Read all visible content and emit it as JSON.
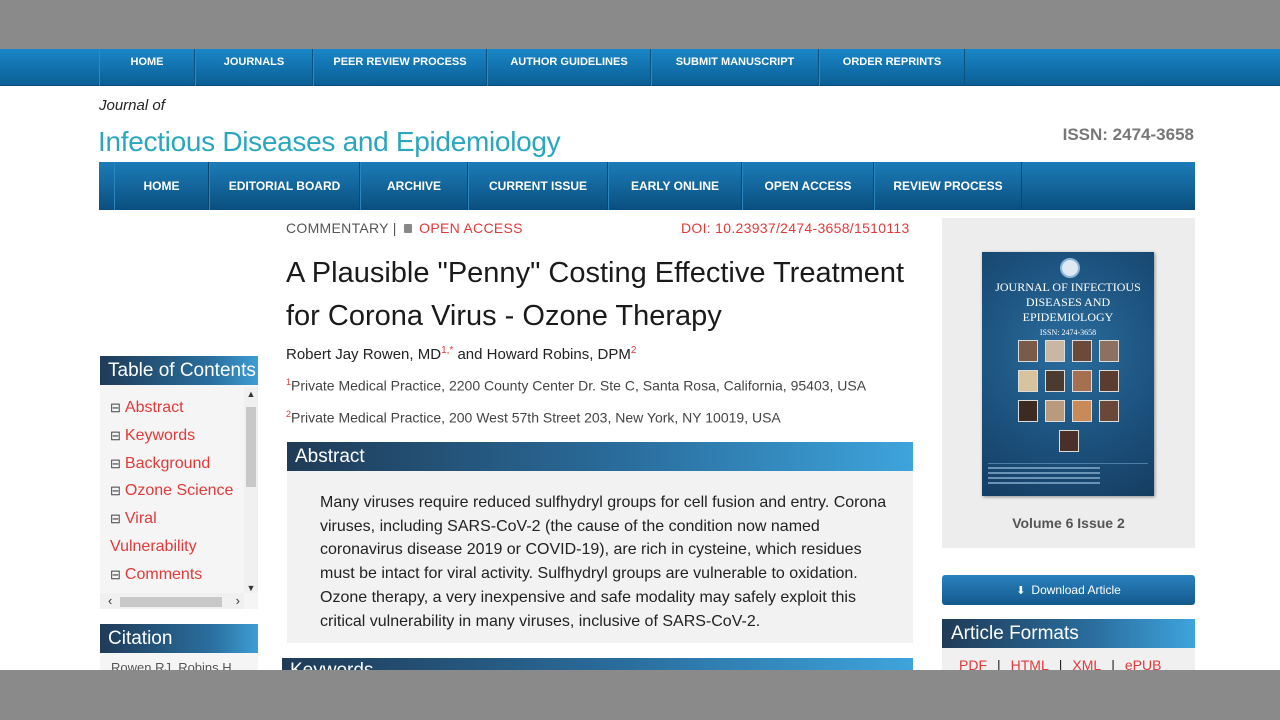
{
  "top_nav": [
    "HOME",
    "JOURNALS",
    "PEER REVIEW PROCESS",
    "AUTHOR GUIDELINES",
    "SUBMIT MANUSCRIPT",
    "ORDER REPRINTS"
  ],
  "header": {
    "journal_of": "Journal of",
    "journal_title": "Infectious Diseases and Epidemiology",
    "issn": "ISSN: 2474-3658"
  },
  "main_nav": [
    "HOME",
    "EDITORIAL BOARD",
    "ARCHIVE",
    "CURRENT ISSUE",
    "EARLY ONLINE",
    "OPEN ACCESS",
    "REVIEW PROCESS"
  ],
  "sidebar": {
    "toc_title": "Table of Contents",
    "toc_items": [
      "Abstract",
      "Keywords",
      "Background",
      "Ozone Science",
      "Viral Vulnerability",
      "Comments"
    ],
    "citation_title": "Citation",
    "citation_text": "Rowen RJ, Robins H"
  },
  "article": {
    "type": "COMMENTARY",
    "separator": "|",
    "open_access": "OPEN ACCESS",
    "doi": "DOI: 10.23937/2474-3658/1510113",
    "title": "A Plausible \"Penny\" Costing Effective Treatment for Corona Virus - Ozone Therapy",
    "author1": "Robert Jay Rowen, MD",
    "author1_sup": "1,*",
    "and": " and ",
    "author2": "Howard Robins, DPM",
    "author2_sup": "2",
    "aff1_num": "1",
    "aff1": "Private Medical Practice, 2200 County Center Dr. Ste C, Santa Rosa, California, 95403, USA",
    "aff2_num": "2",
    "aff2": "Private Medical Practice, 200 West 57th Street 203, New York, NY 10019, USA",
    "abstract_title": "Abstract",
    "abstract_text": "Many viruses require reduced sulfhydryl groups for cell fusion and entry. Corona viruses, including SARS-CoV-2 (the cause of the condition now named coronavirus disease 2019 or COVID-19), are rich in cysteine, which residues must be intact for viral activity. Sulfhydryl groups are vulnerable to oxidation. Ozone therapy, a very inexpensive and safe modality may safely exploit this critical vulnerability in many viruses, inclusive of SARS-CoV-2.",
    "keywords_title": "Keywords"
  },
  "right": {
    "cover_title": "JOURNAL OF INFECTIOUS DISEASES AND EPIDEMIOLOGY",
    "cover_issn": "ISSN: 2474-3658",
    "volume": "Volume 6 Issue 2",
    "download": "Download Article",
    "formats_title": "Article Formats",
    "formats": [
      "PDF",
      "HTML",
      "XML",
      "ePUB"
    ]
  },
  "colors": {
    "accent_blue": "#1a86c7",
    "journal_title_teal": "#2aa7bf",
    "link_red": "#e03a3a"
  }
}
